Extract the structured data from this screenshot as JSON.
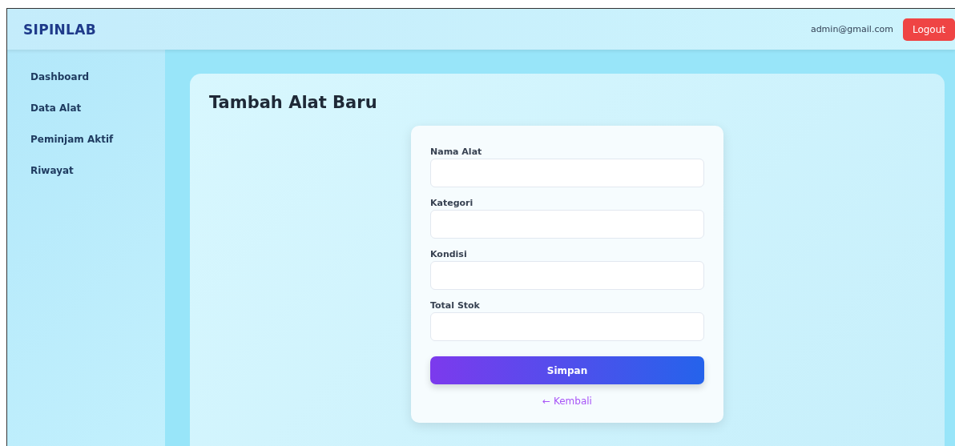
{
  "header": {
    "brand": "SIPINLAB",
    "user_email": "admin@gmail.com",
    "logout_button": "Logout"
  },
  "sidebar": {
    "items": [
      {
        "label": "Dashboard"
      },
      {
        "label": "Data Alat"
      },
      {
        "label": "Peminjam Aktif"
      },
      {
        "label": "Riwayat"
      }
    ]
  },
  "page": {
    "title": "Tambah Alat Baru"
  },
  "form": {
    "fields": [
      {
        "label": "Nama Alat"
      },
      {
        "label": "Kategori"
      },
      {
        "label": "Kondisi"
      },
      {
        "label": "Total Stok"
      }
    ],
    "submit_button": "Simpan",
    "back_link": "← Kembali"
  }
}
